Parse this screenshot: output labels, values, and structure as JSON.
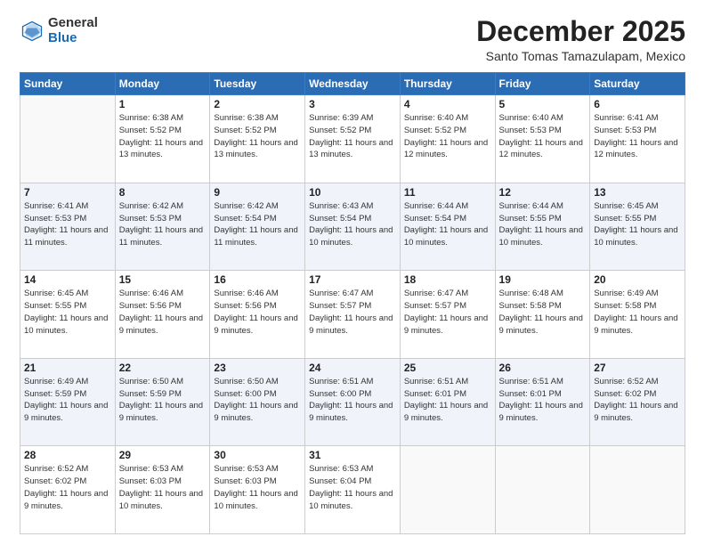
{
  "logo": {
    "general": "General",
    "blue": "Blue"
  },
  "header": {
    "month": "December 2025",
    "location": "Santo Tomas Tamazulapam, Mexico"
  },
  "weekdays": [
    "Sunday",
    "Monday",
    "Tuesday",
    "Wednesday",
    "Thursday",
    "Friday",
    "Saturday"
  ],
  "weeks": [
    [
      {
        "day": "",
        "sunrise": "",
        "sunset": "",
        "daylight": ""
      },
      {
        "day": "1",
        "sunrise": "Sunrise: 6:38 AM",
        "sunset": "Sunset: 5:52 PM",
        "daylight": "Daylight: 11 hours and 13 minutes."
      },
      {
        "day": "2",
        "sunrise": "Sunrise: 6:38 AM",
        "sunset": "Sunset: 5:52 PM",
        "daylight": "Daylight: 11 hours and 13 minutes."
      },
      {
        "day": "3",
        "sunrise": "Sunrise: 6:39 AM",
        "sunset": "Sunset: 5:52 PM",
        "daylight": "Daylight: 11 hours and 13 minutes."
      },
      {
        "day": "4",
        "sunrise": "Sunrise: 6:40 AM",
        "sunset": "Sunset: 5:52 PM",
        "daylight": "Daylight: 11 hours and 12 minutes."
      },
      {
        "day": "5",
        "sunrise": "Sunrise: 6:40 AM",
        "sunset": "Sunset: 5:53 PM",
        "daylight": "Daylight: 11 hours and 12 minutes."
      },
      {
        "day": "6",
        "sunrise": "Sunrise: 6:41 AM",
        "sunset": "Sunset: 5:53 PM",
        "daylight": "Daylight: 11 hours and 12 minutes."
      }
    ],
    [
      {
        "day": "7",
        "sunrise": "Sunrise: 6:41 AM",
        "sunset": "Sunset: 5:53 PM",
        "daylight": "Daylight: 11 hours and 11 minutes."
      },
      {
        "day": "8",
        "sunrise": "Sunrise: 6:42 AM",
        "sunset": "Sunset: 5:53 PM",
        "daylight": "Daylight: 11 hours and 11 minutes."
      },
      {
        "day": "9",
        "sunrise": "Sunrise: 6:42 AM",
        "sunset": "Sunset: 5:54 PM",
        "daylight": "Daylight: 11 hours and 11 minutes."
      },
      {
        "day": "10",
        "sunrise": "Sunrise: 6:43 AM",
        "sunset": "Sunset: 5:54 PM",
        "daylight": "Daylight: 11 hours and 10 minutes."
      },
      {
        "day": "11",
        "sunrise": "Sunrise: 6:44 AM",
        "sunset": "Sunset: 5:54 PM",
        "daylight": "Daylight: 11 hours and 10 minutes."
      },
      {
        "day": "12",
        "sunrise": "Sunrise: 6:44 AM",
        "sunset": "Sunset: 5:55 PM",
        "daylight": "Daylight: 11 hours and 10 minutes."
      },
      {
        "day": "13",
        "sunrise": "Sunrise: 6:45 AM",
        "sunset": "Sunset: 5:55 PM",
        "daylight": "Daylight: 11 hours and 10 minutes."
      }
    ],
    [
      {
        "day": "14",
        "sunrise": "Sunrise: 6:45 AM",
        "sunset": "Sunset: 5:55 PM",
        "daylight": "Daylight: 11 hours and 10 minutes."
      },
      {
        "day": "15",
        "sunrise": "Sunrise: 6:46 AM",
        "sunset": "Sunset: 5:56 PM",
        "daylight": "Daylight: 11 hours and 9 minutes."
      },
      {
        "day": "16",
        "sunrise": "Sunrise: 6:46 AM",
        "sunset": "Sunset: 5:56 PM",
        "daylight": "Daylight: 11 hours and 9 minutes."
      },
      {
        "day": "17",
        "sunrise": "Sunrise: 6:47 AM",
        "sunset": "Sunset: 5:57 PM",
        "daylight": "Daylight: 11 hours and 9 minutes."
      },
      {
        "day": "18",
        "sunrise": "Sunrise: 6:47 AM",
        "sunset": "Sunset: 5:57 PM",
        "daylight": "Daylight: 11 hours and 9 minutes."
      },
      {
        "day": "19",
        "sunrise": "Sunrise: 6:48 AM",
        "sunset": "Sunset: 5:58 PM",
        "daylight": "Daylight: 11 hours and 9 minutes."
      },
      {
        "day": "20",
        "sunrise": "Sunrise: 6:49 AM",
        "sunset": "Sunset: 5:58 PM",
        "daylight": "Daylight: 11 hours and 9 minutes."
      }
    ],
    [
      {
        "day": "21",
        "sunrise": "Sunrise: 6:49 AM",
        "sunset": "Sunset: 5:59 PM",
        "daylight": "Daylight: 11 hours and 9 minutes."
      },
      {
        "day": "22",
        "sunrise": "Sunrise: 6:50 AM",
        "sunset": "Sunset: 5:59 PM",
        "daylight": "Daylight: 11 hours and 9 minutes."
      },
      {
        "day": "23",
        "sunrise": "Sunrise: 6:50 AM",
        "sunset": "Sunset: 6:00 PM",
        "daylight": "Daylight: 11 hours and 9 minutes."
      },
      {
        "day": "24",
        "sunrise": "Sunrise: 6:51 AM",
        "sunset": "Sunset: 6:00 PM",
        "daylight": "Daylight: 11 hours and 9 minutes."
      },
      {
        "day": "25",
        "sunrise": "Sunrise: 6:51 AM",
        "sunset": "Sunset: 6:01 PM",
        "daylight": "Daylight: 11 hours and 9 minutes."
      },
      {
        "day": "26",
        "sunrise": "Sunrise: 6:51 AM",
        "sunset": "Sunset: 6:01 PM",
        "daylight": "Daylight: 11 hours and 9 minutes."
      },
      {
        "day": "27",
        "sunrise": "Sunrise: 6:52 AM",
        "sunset": "Sunset: 6:02 PM",
        "daylight": "Daylight: 11 hours and 9 minutes."
      }
    ],
    [
      {
        "day": "28",
        "sunrise": "Sunrise: 6:52 AM",
        "sunset": "Sunset: 6:02 PM",
        "daylight": "Daylight: 11 hours and 9 minutes."
      },
      {
        "day": "29",
        "sunrise": "Sunrise: 6:53 AM",
        "sunset": "Sunset: 6:03 PM",
        "daylight": "Daylight: 11 hours and 10 minutes."
      },
      {
        "day": "30",
        "sunrise": "Sunrise: 6:53 AM",
        "sunset": "Sunset: 6:03 PM",
        "daylight": "Daylight: 11 hours and 10 minutes."
      },
      {
        "day": "31",
        "sunrise": "Sunrise: 6:53 AM",
        "sunset": "Sunset: 6:04 PM",
        "daylight": "Daylight: 11 hours and 10 minutes."
      },
      {
        "day": "",
        "sunrise": "",
        "sunset": "",
        "daylight": ""
      },
      {
        "day": "",
        "sunrise": "",
        "sunset": "",
        "daylight": ""
      },
      {
        "day": "",
        "sunrise": "",
        "sunset": "",
        "daylight": ""
      }
    ]
  ]
}
